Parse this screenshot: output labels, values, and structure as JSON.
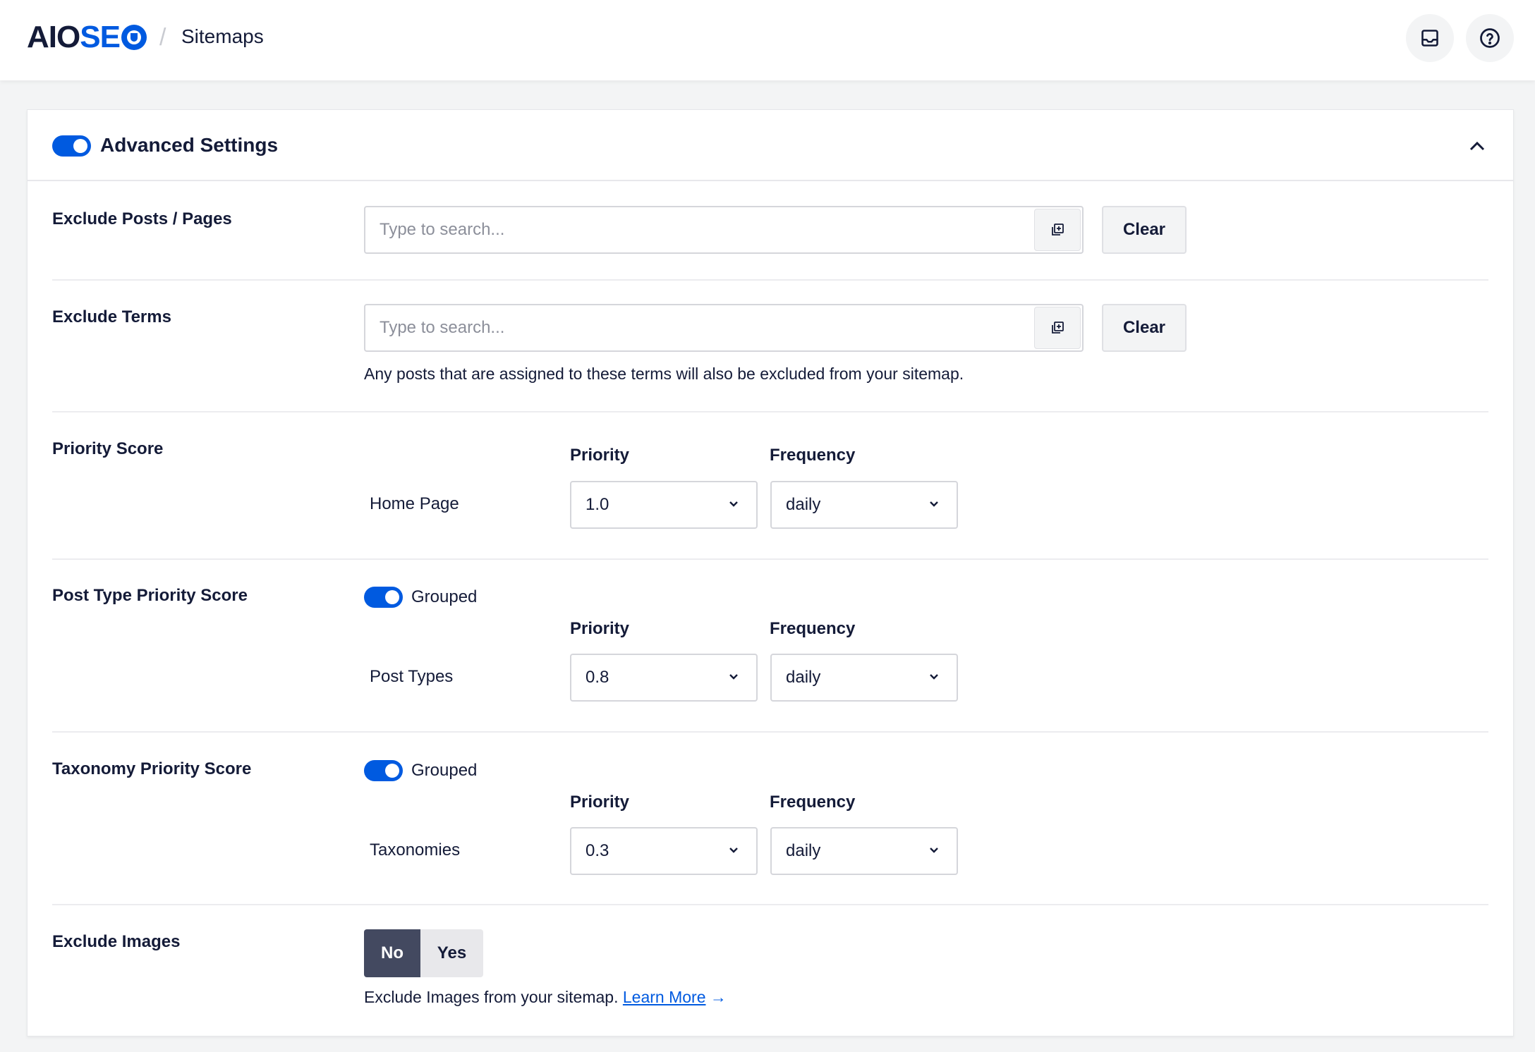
{
  "header": {
    "logo_aio": "AIO",
    "logo_seo": "SE",
    "breadcrumb_separator": "/",
    "breadcrumb_current": "Sitemaps",
    "icons": [
      "inbox-icon",
      "help-icon"
    ]
  },
  "card": {
    "title": "Advanced Settings",
    "enabled": true,
    "collapse_icon": "chevron-up-icon"
  },
  "exclude_posts": {
    "label": "Exclude Posts / Pages",
    "placeholder": "Type to search...",
    "value": "",
    "addon_icon": "add-multiple-icon",
    "clear_label": "Clear"
  },
  "exclude_terms": {
    "label": "Exclude Terms",
    "placeholder": "Type to search...",
    "value": "",
    "addon_icon": "add-multiple-icon",
    "clear_label": "Clear",
    "help": "Any posts that are assigned to these terms will also be excluded from your sitemap."
  },
  "priority_score": {
    "label": "Priority Score",
    "priority_header": "Priority",
    "frequency_header": "Frequency",
    "item_label": "Home Page",
    "priority": "1.0",
    "frequency": "daily"
  },
  "post_type_priority": {
    "label": "Post Type Priority Score",
    "grouped_label": "Grouped",
    "grouped": true,
    "priority_header": "Priority",
    "frequency_header": "Frequency",
    "item_label": "Post Types",
    "priority": "0.8",
    "frequency": "daily"
  },
  "taxonomy_priority": {
    "label": "Taxonomy Priority Score",
    "grouped_label": "Grouped",
    "grouped": true,
    "priority_header": "Priority",
    "frequency_header": "Frequency",
    "item_label": "Taxonomies",
    "priority": "0.3",
    "frequency": "daily"
  },
  "exclude_images": {
    "label": "Exclude Images",
    "options": [
      "No",
      "Yes"
    ],
    "selected": "No",
    "help": "Exclude Images from your sitemap.",
    "learn_more": "Learn More",
    "learn_more_arrow": "→"
  },
  "colors": {
    "brand_blue": "#005ae0",
    "text_dark": "#141b38",
    "selected_dark": "#434960"
  }
}
